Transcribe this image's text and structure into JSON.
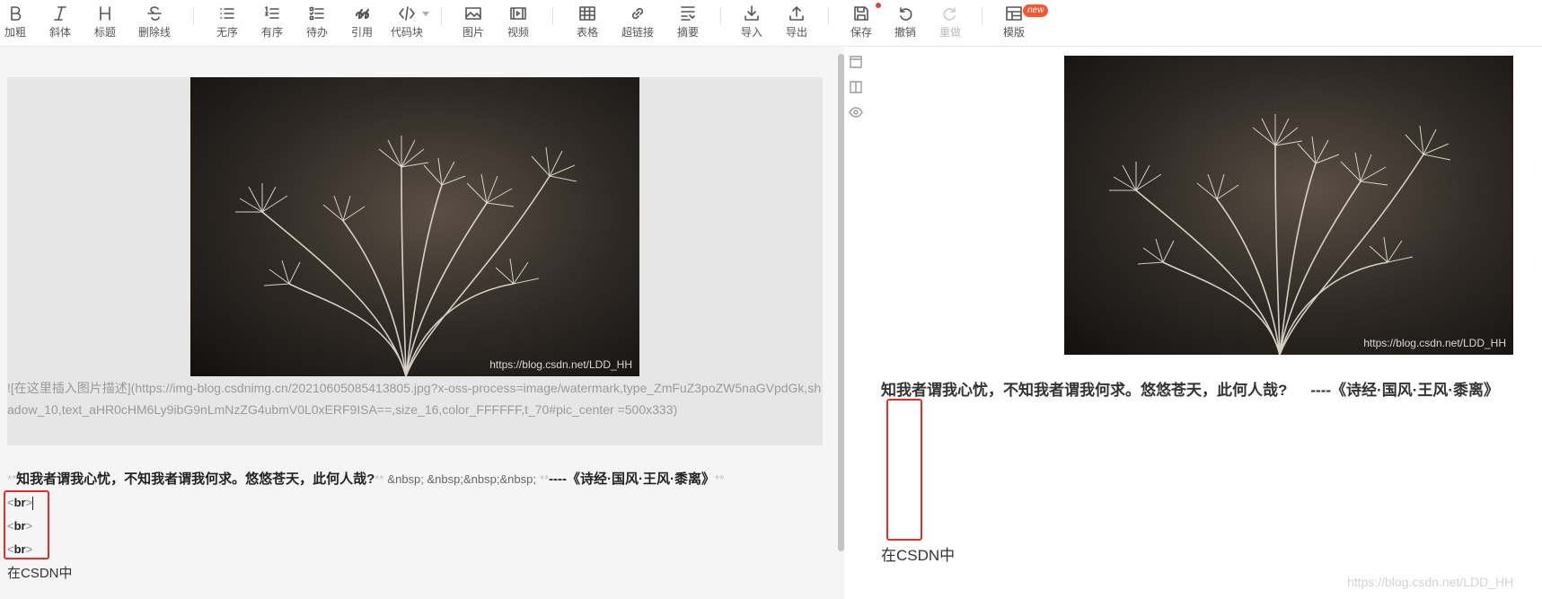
{
  "toolbar": {
    "items": [
      {
        "icon": "bold-icon",
        "label": "加粗"
      },
      {
        "icon": "italic-icon",
        "label": "斜体"
      },
      {
        "icon": "heading-icon",
        "label": "标题"
      },
      {
        "icon": "strikethrough-icon",
        "label": "删除线"
      },
      {
        "icon": "unordered-list-icon",
        "label": "无序"
      },
      {
        "icon": "ordered-list-icon",
        "label": "有序"
      },
      {
        "icon": "todo-list-icon",
        "label": "待办"
      },
      {
        "icon": "quote-icon",
        "label": "引用"
      },
      {
        "icon": "code-block-icon",
        "label": "代码块"
      },
      {
        "icon": "image-icon",
        "label": "图片"
      },
      {
        "icon": "video-icon",
        "label": "视频"
      },
      {
        "icon": "table-icon",
        "label": "表格"
      },
      {
        "icon": "link-icon",
        "label": "超链接"
      },
      {
        "icon": "summary-icon",
        "label": "摘要"
      },
      {
        "icon": "import-icon",
        "label": "导入"
      },
      {
        "icon": "export-icon",
        "label": "导出"
      },
      {
        "icon": "save-icon",
        "label": "保存"
      },
      {
        "icon": "undo-icon",
        "label": "撤销"
      },
      {
        "icon": "redo-icon",
        "label": "重做"
      },
      {
        "icon": "template-icon",
        "label": "模版"
      }
    ],
    "new_badge": "new"
  },
  "editor": {
    "image_watermark": "https://blog.csdn.net/LDD_HH",
    "image_markdown": "![在这里插入图片描述](https://img-blog.csdnimg.cn/20210605085413805.jpg?x-oss-process=image/watermark,type_ZmFuZ3poZW5naGVpdGk,shadow_10,text_aHR0cHM6Ly9ibG9nLmNzZG4ubmV0L0xERF9ISA==,size_16,color_FFFFFF,t_70#pic_center =500x333)",
    "bold_marker": "**",
    "poem": "知我者谓我心忧，不知我者谓我何求。悠悠苍天，此何人哉?",
    "entities": "&nbsp; &nbsp;&nbsp;&nbsp;",
    "source": "----《诗经·国风·王风·黍离》",
    "br_lt": "<",
    "br_tag": "br",
    "br_gt": ">",
    "last_line": "在CSDN中"
  },
  "preview": {
    "image_watermark": "https://blog.csdn.net/LDD_HH",
    "poem": "知我者谓我心忧，不知我者谓我何求。悠悠苍天，此何人哉?",
    "source": "----《诗经·国风·王风·黍离》",
    "last_line": "在CSDN中"
  },
  "page_watermark": "https://blog.csdn.net/LDD_HH",
  "colors": {
    "highlight_box": "#e12d2d",
    "badge": "#fc5531",
    "editor_bg": "#f5f5f5"
  }
}
